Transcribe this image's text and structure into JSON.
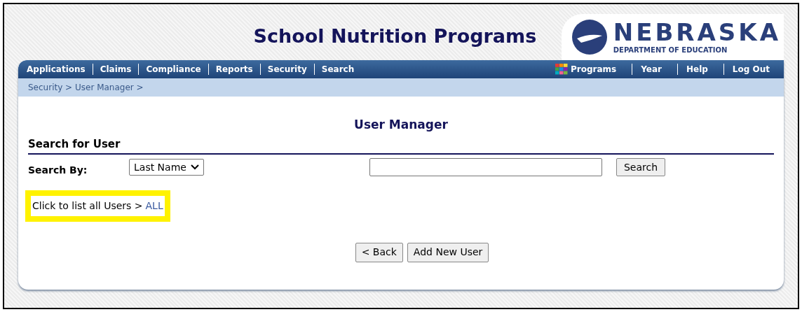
{
  "header": {
    "title": "School Nutrition Programs",
    "logo_name": "NEBRASKA",
    "logo_subtitle": "DEPARTMENT OF EDUCATION"
  },
  "nav": {
    "left": [
      "Applications",
      "Claims",
      "Compliance",
      "Reports",
      "Security",
      "Search"
    ],
    "right": [
      {
        "label": "Programs",
        "kind": "grid"
      },
      {
        "label": "Year",
        "kind": "plain"
      },
      {
        "label": "Help",
        "kind": "plain"
      },
      {
        "label": "Log Out",
        "kind": "plain"
      }
    ]
  },
  "breadcrumb": "Security > User Manager >",
  "page_title": "User Manager",
  "section_title": "Search for User",
  "search": {
    "label": "Search By:",
    "select_value": "Last Name",
    "button": "Search"
  },
  "list_all": {
    "text": "Click to list all Users >",
    "link": "ALL",
    "highlighted": true
  },
  "buttons": [
    "< Back",
    "Add New User"
  ]
}
